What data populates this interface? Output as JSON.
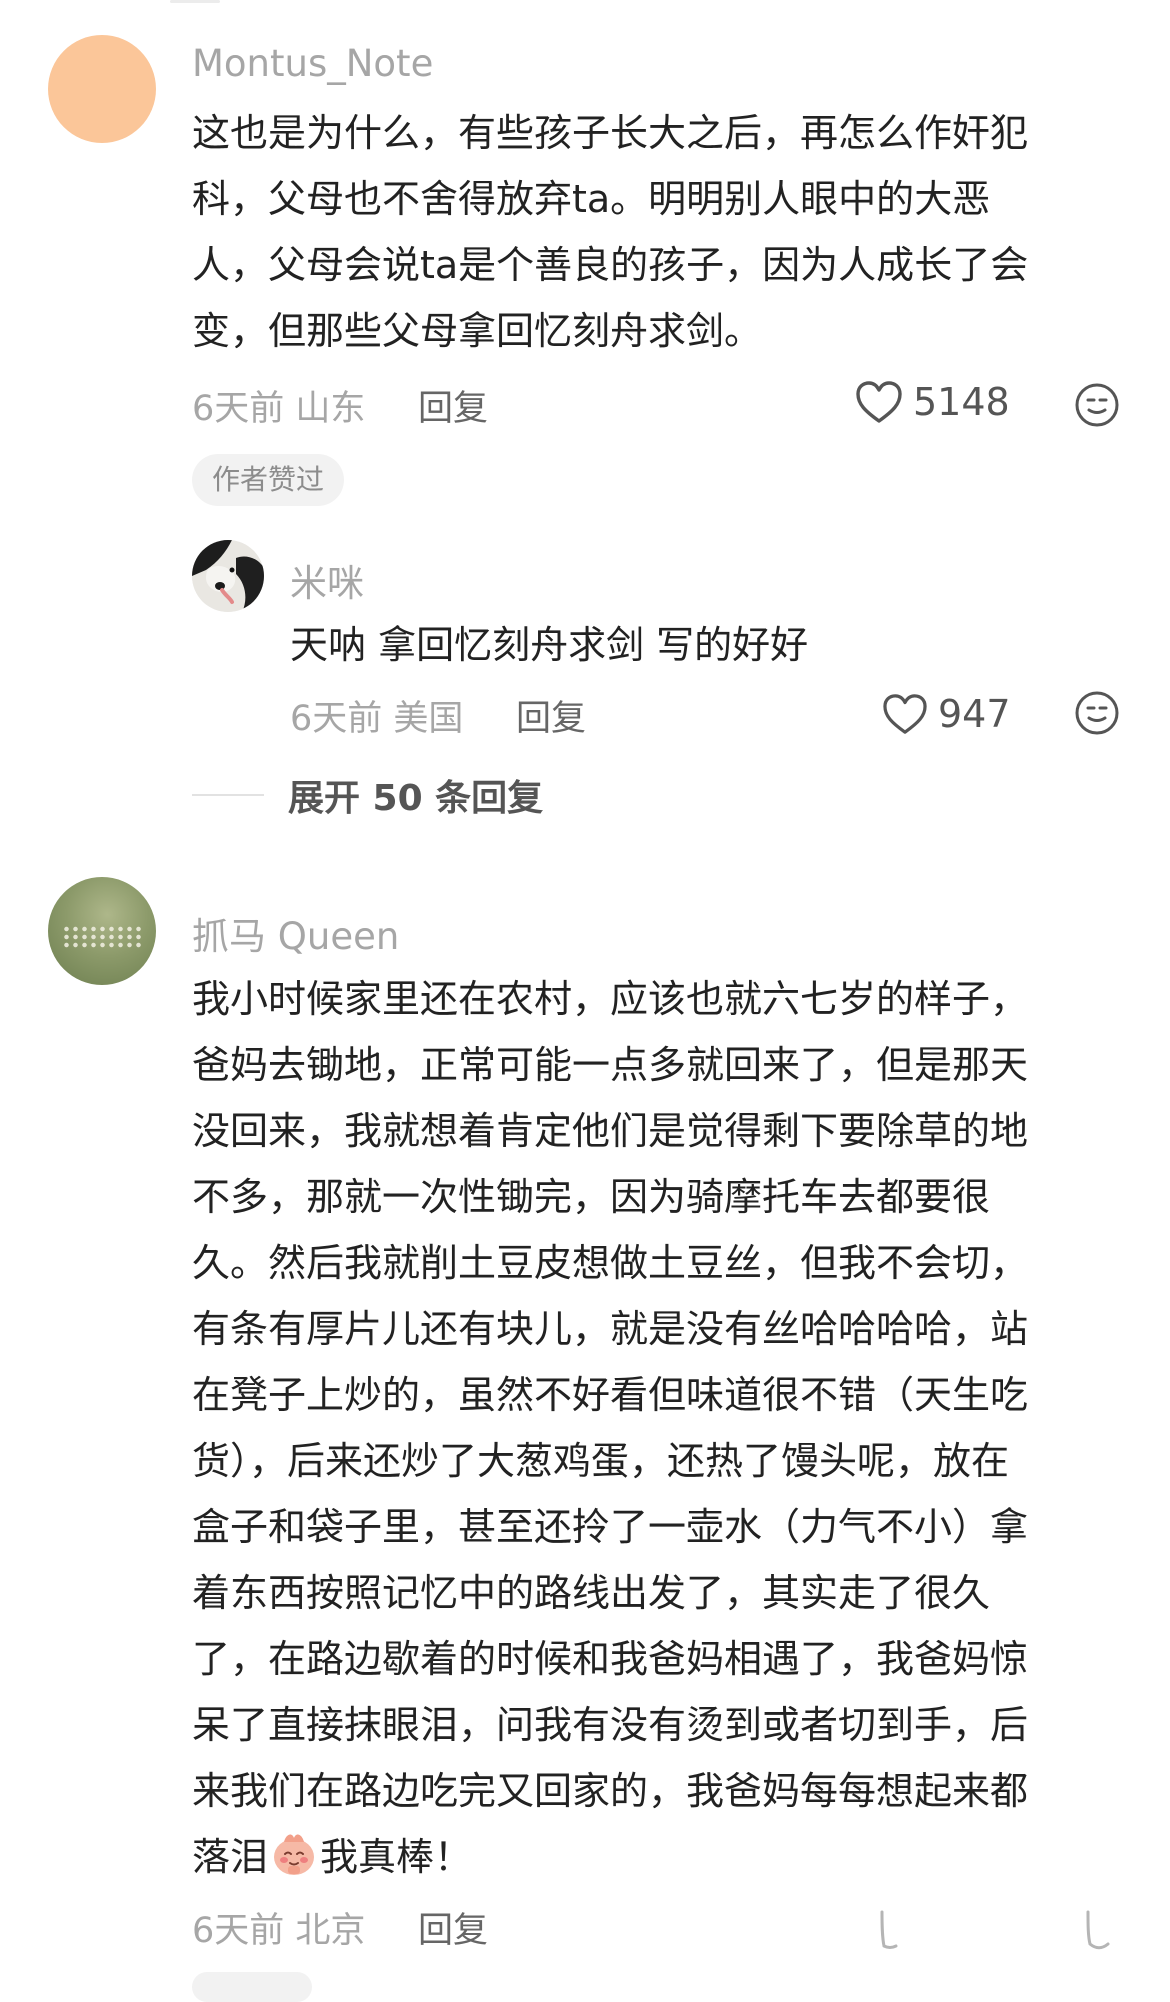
{
  "comments": [
    {
      "username": "Montus_Note",
      "avatar": "peach-circle-avatar",
      "lines": [
        "这也是为什么，有些孩子长大之后，再怎么作奸犯",
        "科，父母也不舍得放弃ta。明明别人眼中的大恶",
        "人，父母会说ta是个善良的孩子，因为人成长了会",
        "变，但那些父母拿回忆刻舟求剑。"
      ],
      "time_location": "6天前 山东",
      "reply_label": "回复",
      "likes": "5148",
      "author_badge": "作者赞过",
      "replies": [
        {
          "username": "米咪",
          "avatar": "dog-avatar",
          "text": "天呐 拿回忆刻舟求剑 写的好好",
          "time_location": "6天前 美国",
          "reply_label": "回复",
          "likes": "947"
        }
      ],
      "expand_label": "展开 50 条回复"
    },
    {
      "username": "抓马 Queen",
      "avatar": "meadow-avatar",
      "lines": [
        "我小时候家里还在农村，应该也就六七岁的样子，",
        "爸妈去锄地，正常可能一点多就回来了，但是那天",
        "没回来，我就想着肯定他们是觉得剩下要除草的地",
        "不多，那就一次性锄完，因为骑摩托车去都要很",
        "久。然后我就削土豆皮想做土豆丝，但我不会切，",
        "有条有厚片儿还有块儿，就是没有丝哈哈哈哈，站",
        "在凳子上炒的，虽然不好看但味道很不错（天生吃",
        "货），后来还炒了大葱鸡蛋，还热了馒头呢，放在",
        "盒子和袋子里，甚至还拎了一壶水（力气不小）拿",
        "着东西按照记忆中的路线出发了，其实走了很久",
        "了，在路边歇着的时候和我爸妈相遇了，我爸妈惊",
        "呆了直接抹眼泪，问我有没有烫到或者切到手，后",
        "来我们在路边吃完又回家的，我爸妈每每想起来都"
      ],
      "last_line_before_emoji": "落泪",
      "inline_emoji": "shy-emoji",
      "last_line_after_emoji": "我真棒！",
      "time_location": "6天前 北京",
      "reply_label": "回复"
    }
  ],
  "icons": {
    "like": "heart-outline-icon",
    "emoji": "smiley-face-icon"
  },
  "colors": {
    "primary_text": "#222222",
    "secondary_text": "#a6a6a6",
    "badge_bg": "#f2f2f2",
    "peach_avatar": "#fbc699"
  }
}
